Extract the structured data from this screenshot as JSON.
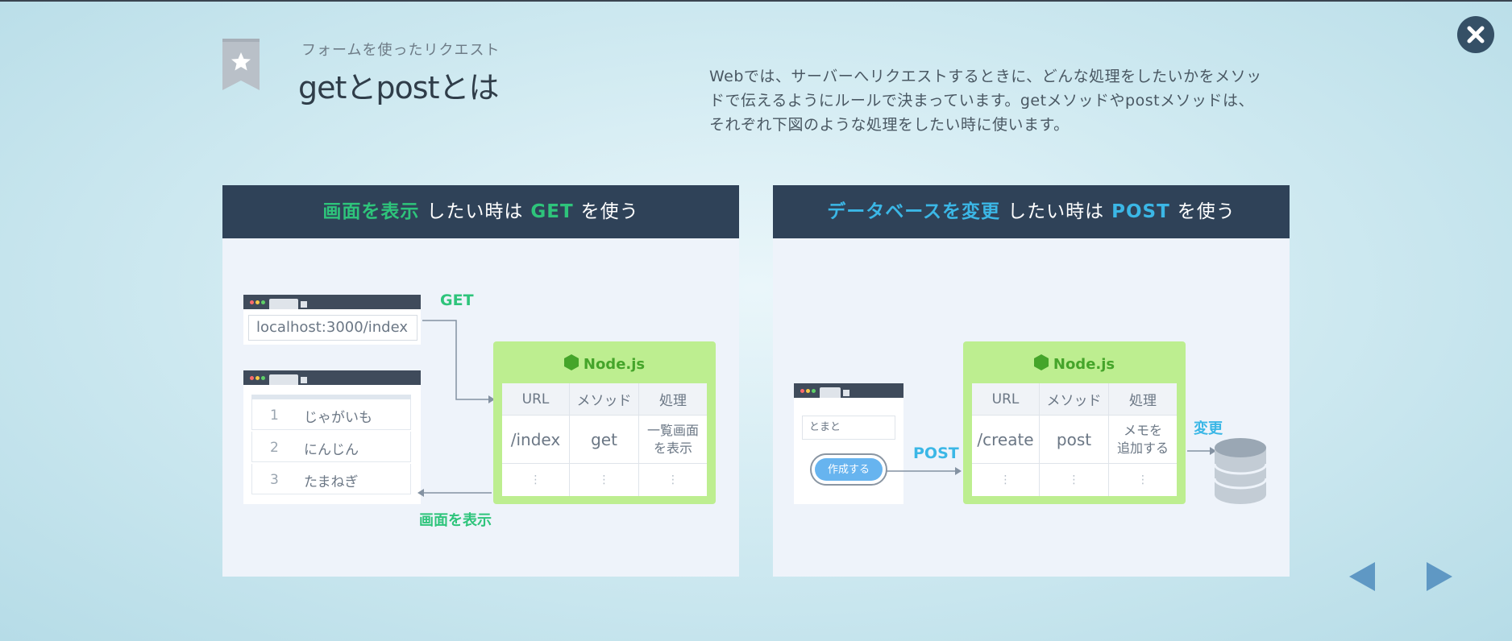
{
  "header": {
    "subtitle": "フォームを使ったリクエスト",
    "title": "getとpostとは",
    "description": "Webでは、サーバーへリクエストするときに、どんな処理をしたいかをメソッドで伝えるようにルールで決まっています。getメソッドやpostメソッドは、それぞれ下図のような処理をしたい時に使います。"
  },
  "icons": {
    "bookmark": "star-bookmark-icon",
    "close": "close-icon",
    "node": "nodejs-hexagon-icon",
    "database": "database-icon",
    "prev": "arrow-left-icon",
    "next": "arrow-right-icon"
  },
  "colors": {
    "green": "#2ec47b",
    "blue": "#3bb7e6",
    "panel_header": "#2f4258",
    "node_bg": "#bdee90",
    "node_text": "#45a52a"
  },
  "get_panel": {
    "heading_highlight": "画面を表示",
    "heading_mid": "したい時は",
    "heading_method": "GET",
    "heading_end": "を使う",
    "url": "localhost:3000/index",
    "get_label": "GET",
    "response_label": "画面を表示",
    "list": [
      {
        "num": "1",
        "text": "じゃがいも"
      },
      {
        "num": "2",
        "text": "にんじん"
      },
      {
        "num": "3",
        "text": "たまねぎ"
      }
    ],
    "node_title": "Node.js",
    "table_headers": [
      "URL",
      "メソッド",
      "処理"
    ],
    "row": [
      "/index",
      "get",
      "一覧画面\nを表示"
    ],
    "dots": "⋮"
  },
  "post_panel": {
    "heading_highlight": "データベースを変更",
    "heading_mid": "したい時は",
    "heading_method": "POST",
    "heading_end": "を使う",
    "input_value": "とまと",
    "button_label": "作成する",
    "post_label": "POST",
    "change_label": "変更",
    "node_title": "Node.js",
    "table_headers": [
      "URL",
      "メソッド",
      "処理"
    ],
    "row": [
      "/create",
      "post",
      "メモを\n追加する"
    ],
    "dots": "⋮"
  }
}
